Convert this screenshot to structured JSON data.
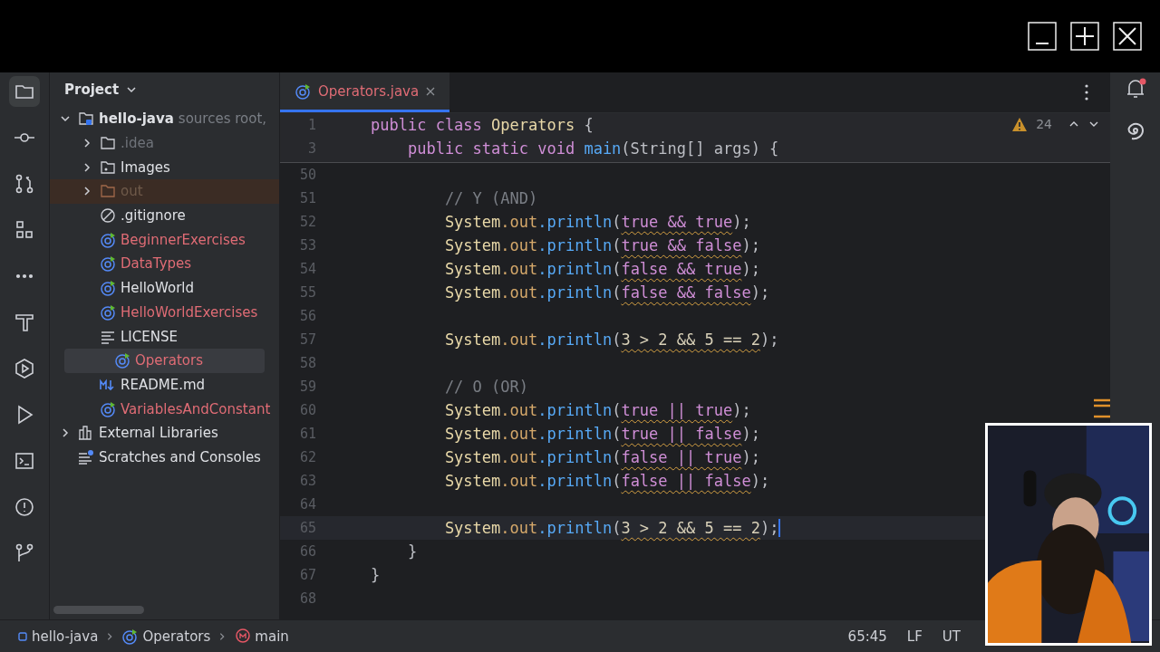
{
  "window_controls": [
    {
      "kind": "minimize"
    },
    {
      "kind": "maximize"
    },
    {
      "kind": "close"
    }
  ],
  "left_toolbar": [
    {
      "kind": "folder",
      "selected": true
    },
    {
      "kind": "commit",
      "selected": false
    },
    {
      "kind": "pull",
      "selected": false
    },
    {
      "kind": "structure",
      "selected": false
    },
    {
      "kind": "more",
      "selected": false
    },
    {
      "kind": "build",
      "selected": false
    },
    {
      "kind": "services",
      "selected": false
    },
    {
      "kind": "run",
      "selected": false
    },
    {
      "kind": "terminal",
      "selected": false
    },
    {
      "kind": "problems",
      "selected": false
    },
    {
      "kind": "git",
      "selected": false
    }
  ],
  "project_panel": {
    "title": "Project",
    "tree": [
      {
        "kind": "module",
        "label": "hello-java",
        "hint": "sources root,",
        "expanded": true,
        "selected": false,
        "excluded": false,
        "color": "#dfe1e5",
        "children": [
          {
            "kind": "folder",
            "label": ".idea",
            "expanded": false,
            "selected": false,
            "excluded": false,
            "color": "#6f737a"
          },
          {
            "kind": "images",
            "label": "Images",
            "expanded": false,
            "selected": false,
            "excluded": false,
            "color": "#dfe1e5"
          },
          {
            "kind": "folder",
            "label": "out",
            "expanded": false,
            "selected": false,
            "excluded": true,
            "color": "#6f5a4a"
          },
          {
            "kind": "ignore",
            "label": ".gitignore",
            "selected": false,
            "excluded": false,
            "color": "#dfe1e5"
          },
          {
            "kind": "class",
            "label": "BeginnerExercises",
            "selected": false,
            "excluded": false,
            "color": "#e06c75"
          },
          {
            "kind": "class",
            "label": "DataTypes",
            "selected": false,
            "excluded": false,
            "color": "#e06c75"
          },
          {
            "kind": "class",
            "label": "HelloWorld",
            "selected": false,
            "excluded": false,
            "color": "#dfe1e5"
          },
          {
            "kind": "class",
            "label": "HelloWorldExercises",
            "selected": false,
            "excluded": false,
            "color": "#e06c75"
          },
          {
            "kind": "text",
            "label": "LICENSE",
            "selected": false,
            "excluded": false,
            "color": "#dfe1e5"
          },
          {
            "kind": "class",
            "label": "Operators",
            "selected": true,
            "excluded": false,
            "color": "#e06c75"
          },
          {
            "kind": "markdown",
            "label": "README.md",
            "selected": false,
            "excluded": false,
            "color": "#dfe1e5"
          },
          {
            "kind": "class",
            "label": "VariablesAndConstant",
            "selected": false,
            "excluded": false,
            "color": "#e06c75"
          }
        ]
      },
      {
        "kind": "libraries",
        "label": "External Libraries",
        "expanded": false,
        "selected": false,
        "excluded": false,
        "color": "#dfe1e5"
      },
      {
        "kind": "scratches",
        "label": "Scratches and Consoles",
        "selected": false,
        "excluded": false,
        "color": "#dfe1e5"
      }
    ]
  },
  "tabs": [
    {
      "label": "Operators.java",
      "selected": true
    }
  ],
  "inspections": {
    "warnings": "24"
  },
  "sticky_lines": [
    {
      "number": "1",
      "tokens": [
        {
          "text": "public class ",
          "kind": "keyword"
        },
        {
          "text": "Operators ",
          "kind": "type"
        },
        {
          "text": "{",
          "kind": "plain"
        }
      ]
    },
    {
      "number": "3",
      "tokens": [
        {
          "text": "    public static void ",
          "kind": "keyword"
        },
        {
          "text": "main",
          "kind": "method"
        },
        {
          "text": "(String[] args) {",
          "kind": "plain"
        }
      ]
    }
  ],
  "lines": [
    {
      "number": "50",
      "current": false
    },
    {
      "number": "51",
      "current": false,
      "tokens": [
        {
          "text": "        // Y (AND)",
          "kind": "comment"
        }
      ]
    },
    {
      "number": "52",
      "current": false,
      "tokens": [
        {
          "text": "        System",
          "kind": "type"
        },
        {
          "text": ".out",
          "kind": "field"
        },
        {
          "text": ".println",
          "kind": "method"
        },
        {
          "text": "(",
          "kind": "plain"
        },
        {
          "text": "true && true",
          "kind": "literal",
          "warning": true
        },
        {
          "text": ");",
          "kind": "plain"
        }
      ]
    },
    {
      "number": "53",
      "current": false,
      "tokens": [
        {
          "text": "        System",
          "kind": "type"
        },
        {
          "text": ".out",
          "kind": "field"
        },
        {
          "text": ".println",
          "kind": "method"
        },
        {
          "text": "(",
          "kind": "plain"
        },
        {
          "text": "true && false",
          "kind": "literal",
          "warning": true
        },
        {
          "text": ");",
          "kind": "plain"
        }
      ]
    },
    {
      "number": "54",
      "current": false,
      "tokens": [
        {
          "text": "        System",
          "kind": "type"
        },
        {
          "text": ".out",
          "kind": "field"
        },
        {
          "text": ".println",
          "kind": "method"
        },
        {
          "text": "(",
          "kind": "plain"
        },
        {
          "text": "false && true",
          "kind": "literal",
          "warning": true
        },
        {
          "text": ");",
          "kind": "plain"
        }
      ]
    },
    {
      "number": "55",
      "current": false,
      "tokens": [
        {
          "text": "        System",
          "kind": "type"
        },
        {
          "text": ".out",
          "kind": "field"
        },
        {
          "text": ".println",
          "kind": "method"
        },
        {
          "text": "(",
          "kind": "plain"
        },
        {
          "text": "false && false",
          "kind": "literal",
          "warning": true
        },
        {
          "text": ");",
          "kind": "plain"
        }
      ]
    },
    {
      "number": "56",
      "current": false
    },
    {
      "number": "57",
      "current": false,
      "tokens": [
        {
          "text": "        System",
          "kind": "type"
        },
        {
          "text": ".out",
          "kind": "field"
        },
        {
          "text": ".println",
          "kind": "method"
        },
        {
          "text": "(",
          "kind": "plain"
        },
        {
          "text": "3 > 2 && 5 == 2",
          "kind": "number",
          "warning": true
        },
        {
          "text": ");",
          "kind": "plain"
        }
      ]
    },
    {
      "number": "58",
      "current": false
    },
    {
      "number": "59",
      "current": false,
      "tokens": [
        {
          "text": "        // O (OR)",
          "kind": "comment"
        }
      ]
    },
    {
      "number": "60",
      "current": false,
      "tokens": [
        {
          "text": "        System",
          "kind": "type"
        },
        {
          "text": ".out",
          "kind": "field"
        },
        {
          "text": ".println",
          "kind": "method"
        },
        {
          "text": "(",
          "kind": "plain"
        },
        {
          "text": "true || true",
          "kind": "literal",
          "warning": true
        },
        {
          "text": ");",
          "kind": "plain"
        }
      ]
    },
    {
      "number": "61",
      "current": false,
      "tokens": [
        {
          "text": "        System",
          "kind": "type"
        },
        {
          "text": ".out",
          "kind": "field"
        },
        {
          "text": ".println",
          "kind": "method"
        },
        {
          "text": "(",
          "kind": "plain"
        },
        {
          "text": "true || false",
          "kind": "literal",
          "warning": true
        },
        {
          "text": ");",
          "kind": "plain"
        }
      ]
    },
    {
      "number": "62",
      "current": false,
      "tokens": [
        {
          "text": "        System",
          "kind": "type"
        },
        {
          "text": ".out",
          "kind": "field"
        },
        {
          "text": ".println",
          "kind": "method"
        },
        {
          "text": "(",
          "kind": "plain"
        },
        {
          "text": "false || true",
          "kind": "literal",
          "warning": true
        },
        {
          "text": ");",
          "kind": "plain"
        }
      ]
    },
    {
      "number": "63",
      "current": false,
      "tokens": [
        {
          "text": "        System",
          "kind": "type"
        },
        {
          "text": ".out",
          "kind": "field"
        },
        {
          "text": ".println",
          "kind": "method"
        },
        {
          "text": "(",
          "kind": "plain"
        },
        {
          "text": "false || false",
          "kind": "literal",
          "warning": true
        },
        {
          "text": ");",
          "kind": "plain"
        }
      ]
    },
    {
      "number": "64",
      "current": false
    },
    {
      "number": "65",
      "current": true,
      "tokens": [
        {
          "text": "        System",
          "kind": "type"
        },
        {
          "text": ".out",
          "kind": "field"
        },
        {
          "text": ".println",
          "kind": "method"
        },
        {
          "text": "(",
          "kind": "plain"
        },
        {
          "text": "3 > 2 && 5 == 2",
          "kind": "number",
          "warning": true
        },
        {
          "text": ");",
          "kind": "plain"
        }
      ]
    },
    {
      "number": "66",
      "current": false,
      "tokens": [
        {
          "text": "    }",
          "kind": "plain"
        }
      ]
    },
    {
      "number": "67",
      "current": false,
      "tokens": [
        {
          "text": "}",
          "kind": "plain"
        }
      ]
    },
    {
      "number": "68",
      "current": false
    }
  ],
  "breadcrumbs": [
    {
      "kind": "module",
      "label": "hello-java"
    },
    {
      "kind": "class",
      "label": "Operators"
    },
    {
      "kind": "method",
      "label": "main"
    }
  ],
  "status_bar": {
    "position": "65:45",
    "line_separator": "LF",
    "encoding": "UT"
  }
}
